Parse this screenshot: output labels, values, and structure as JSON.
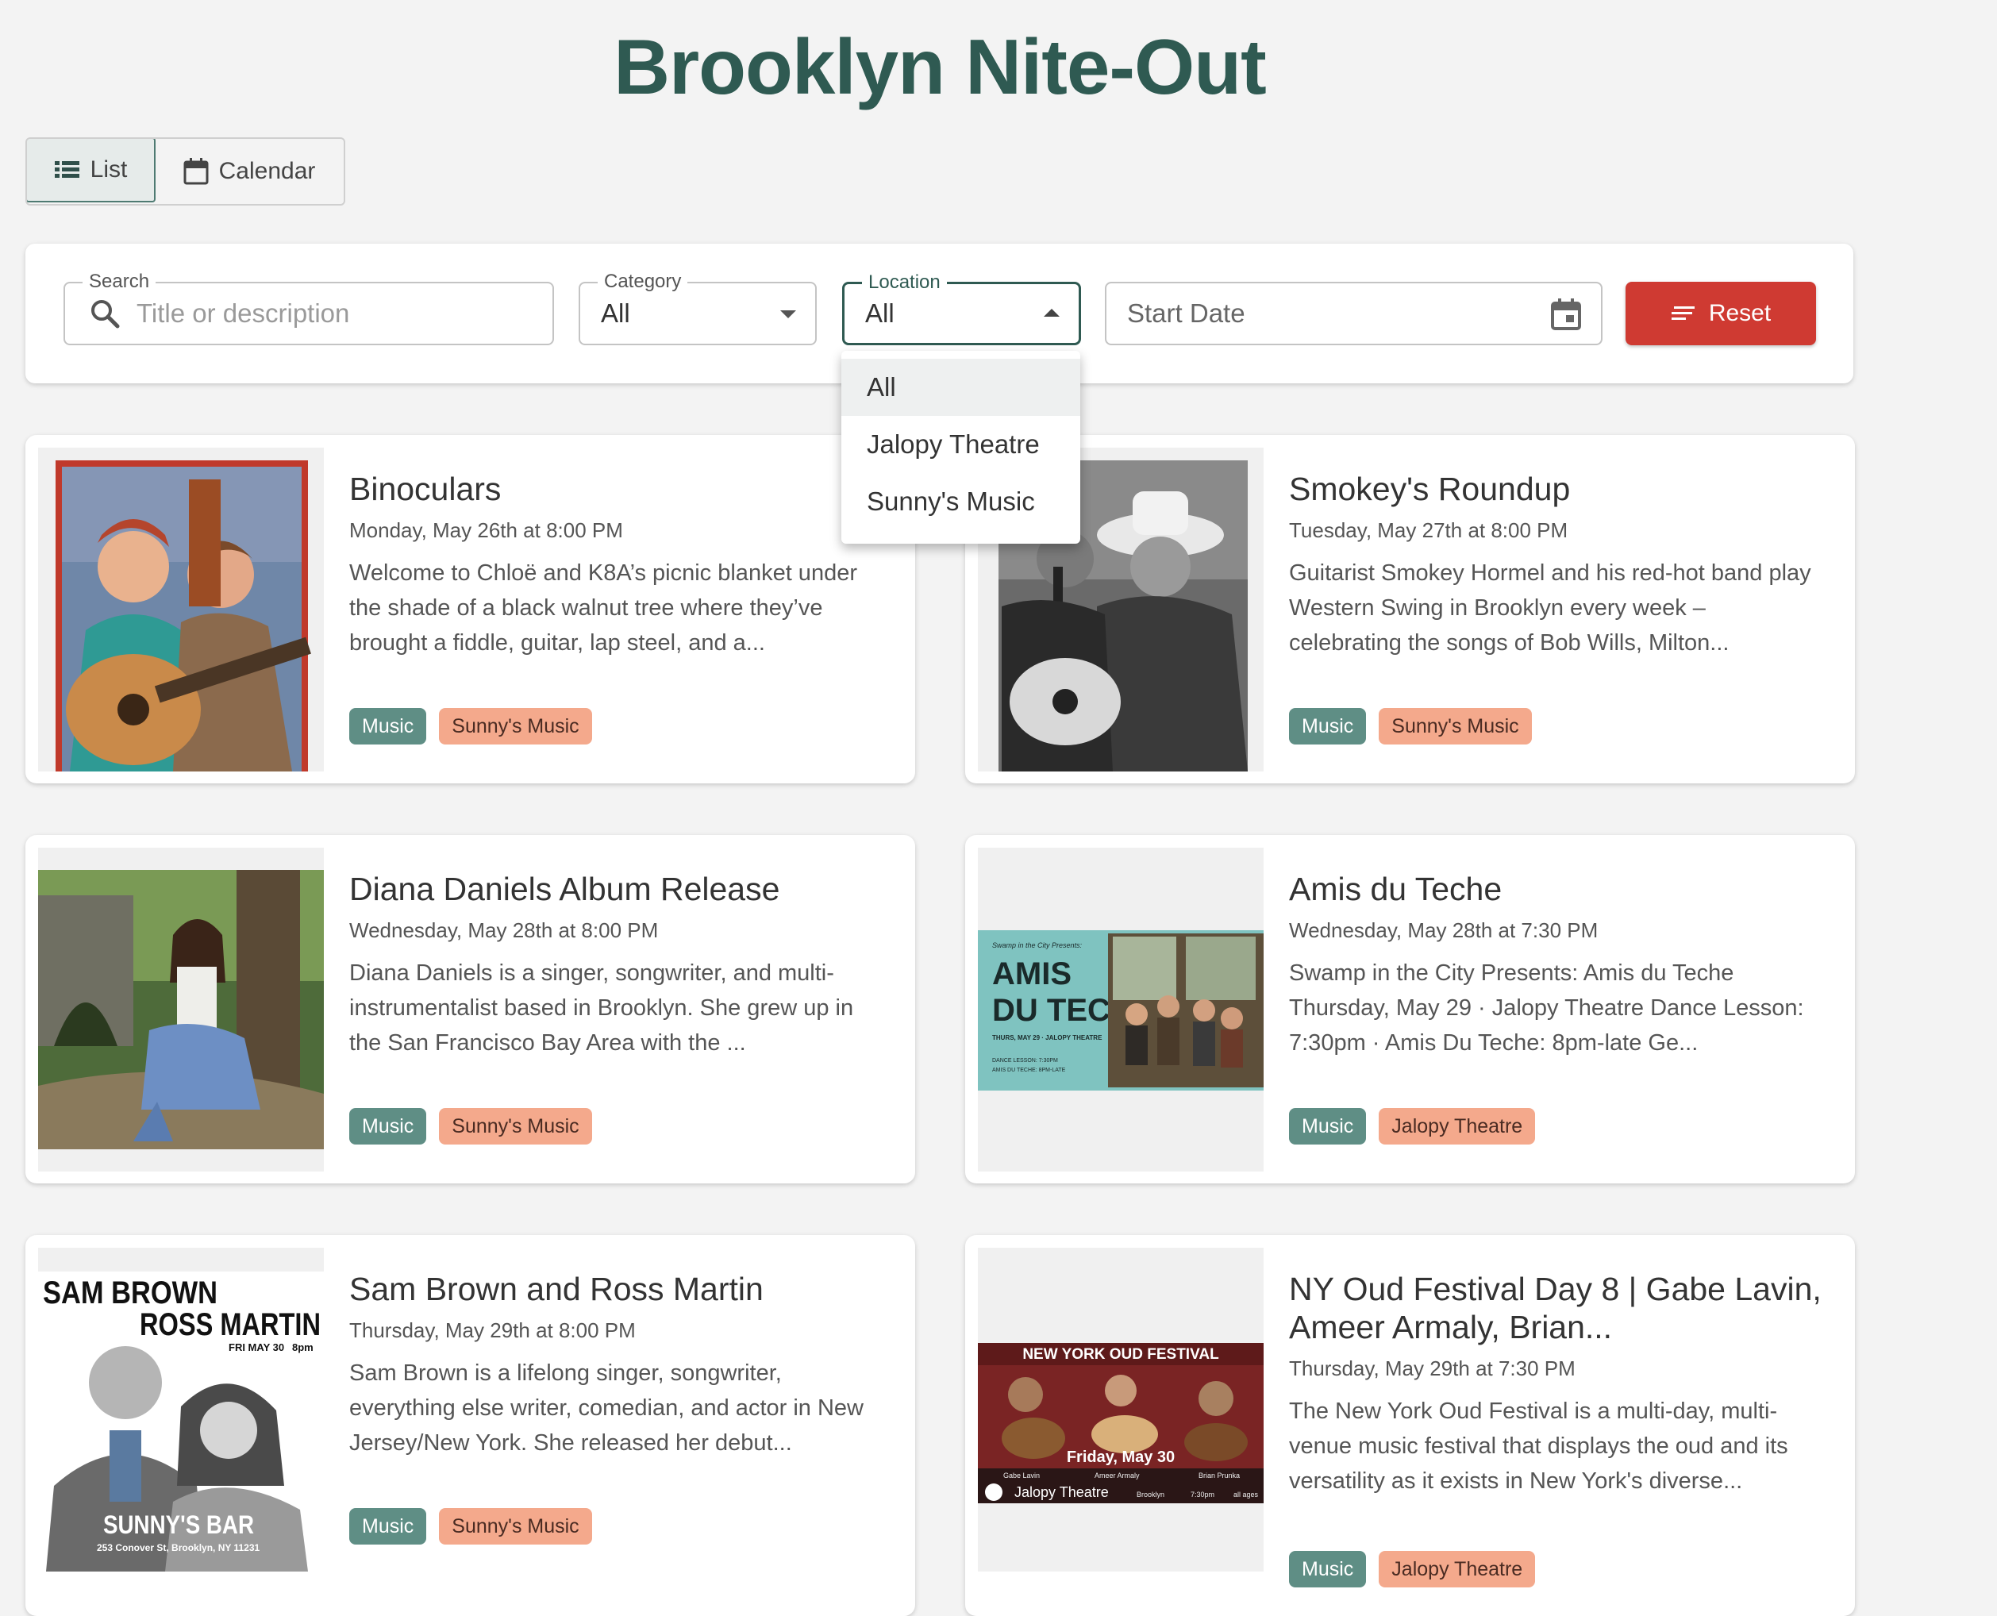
{
  "app": {
    "title": "Brooklyn Nite-Out"
  },
  "view_toggle": {
    "list_label": "List",
    "calendar_label": "Calendar",
    "active": "List"
  },
  "filters": {
    "search": {
      "label": "Search",
      "placeholder": "Title or description"
    },
    "category": {
      "label": "Category",
      "value": "All"
    },
    "location": {
      "label": "Location",
      "value": "All",
      "options": [
        "All",
        "Jalopy Theatre",
        "Sunny's Music"
      ],
      "expanded": true
    },
    "start_date": {
      "placeholder": "Start Date"
    },
    "reset_label": "Reset"
  },
  "colors": {
    "brand": "#2f5a52",
    "reset": "#cf3a32",
    "category_tag": "#5f8e85",
    "location_tag": "#f4a98c"
  },
  "events": [
    {
      "title": "Binoculars",
      "date": "Monday, May 26th at 8:00 PM",
      "description": "Welcome to Chloë and K8A’s picnic blanket under the shade of a black walnut tree where they’ve brought a fiddle, guitar, lap steel, and a...",
      "category": "Music",
      "location": "Sunny's Music"
    },
    {
      "title": "Smokey's Roundup",
      "date": "Tuesday, May 27th at 8:00 PM",
      "description": "Guitarist Smokey Hormel and his red-hot band play Western Swing in Brooklyn every week – celebrating the songs of Bob Wills, Milton...",
      "category": "Music",
      "location": "Sunny's Music"
    },
    {
      "title": "Diana Daniels Album Release",
      "date": "Wednesday, May 28th at 8:00 PM",
      "description": "Diana Daniels is a singer, songwriter, and multi-instrumentalist based in Brooklyn. She grew up in the San Francisco Bay Area with the ...",
      "category": "Music",
      "location": "Sunny's Music"
    },
    {
      "title": "Amis du Teche",
      "date": "Wednesday, May 28th at 7:30 PM",
      "description": "Swamp in the City Presents: Amis du Teche Thursday, May 29 · Jalopy Theatre Dance Lesson: 7:30pm · Amis Du Teche: 8pm-late Ge...",
      "category": "Music",
      "location": "Jalopy Theatre"
    },
    {
      "title": "Sam Brown and Ross Martin",
      "date": "Thursday, May 29th at 8:00 PM",
      "description": "Sam Brown is a lifelong singer, songwriter, everything else writer, comedian, and actor in New Jersey/New York. She released her debut...",
      "category": "Music",
      "location": "Sunny's Music"
    },
    {
      "title": "NY Oud Festival Day 8 | Gabe Lavin, Ameer Armaly, Brian...",
      "date": "Thursday, May 29th at 7:30 PM",
      "description": "The New York Oud Festival is a multi-day, multi-venue music festival that displays the oud and its versatility as it exists in New York's diverse...",
      "category": "Music",
      "location": "Jalopy Theatre"
    }
  ],
  "posters": {
    "amis": {
      "presents": "Swamp in the City Presents:",
      "line1": "AMIS",
      "line2": "DU TECHE",
      "date": "THURS, MAY 29 · JALOPY THEATRE",
      "lesson": "DANCE LESSON: 7:30PM",
      "band": "AMIS DU TECHE: 8PM-LATE"
    },
    "sam": {
      "line1": "SAM BROWN",
      "line2": "ROSS MARTIN",
      "date": "FRI MAY 30",
      "time": "8pm",
      "venue": "SUNNY'S BAR",
      "address": "253 Conover St, Brooklyn, NY 11231"
    },
    "oud": {
      "header": "NEW YORK OUD FESTIVAL",
      "date": "Friday, May 30",
      "p1": "Gabe Lavin",
      "p2": "Ameer Armaly",
      "p3": "Brian Prunka",
      "venue": "Jalopy Theatre",
      "city": "Brooklyn",
      "time": "7:30pm",
      "ages": "all ages"
    }
  }
}
